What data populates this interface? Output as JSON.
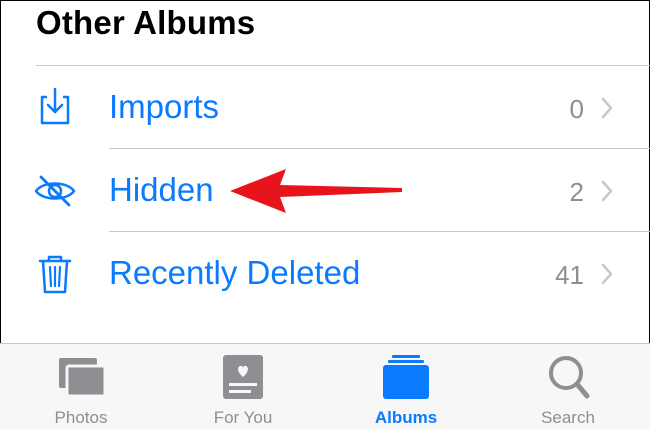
{
  "section": {
    "title": "Other Albums"
  },
  "rows": [
    {
      "label": "Imports",
      "count": "0",
      "icon": "import-icon"
    },
    {
      "label": "Hidden",
      "count": "2",
      "icon": "eye-slash-icon"
    },
    {
      "label": "Recently Deleted",
      "count": "41",
      "icon": "trash-icon"
    }
  ],
  "tabs": [
    {
      "label": "Photos",
      "icon": "photos-icon",
      "active": false
    },
    {
      "label": "For You",
      "icon": "for-you-icon",
      "active": false
    },
    {
      "label": "Albums",
      "icon": "albums-icon",
      "active": true
    },
    {
      "label": "Search",
      "icon": "search-icon",
      "active": false
    }
  ],
  "colors": {
    "accent": "#0a7aff",
    "secondary_text": "#8e8e93",
    "annotation_arrow": "#e8141b"
  }
}
